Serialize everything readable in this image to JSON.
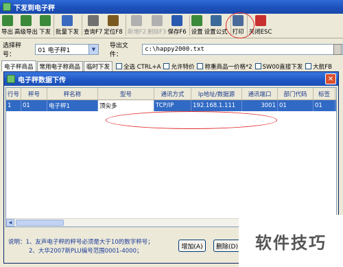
{
  "window": {
    "title": "下发到电子秤"
  },
  "toolbar": {
    "buttons": [
      {
        "label": "导出",
        "icon": "export-icon",
        "color": "#3a8a3a"
      },
      {
        "label": "高级导出",
        "icon": "advanced-export-icon",
        "color": "#3a8a3a"
      },
      {
        "label": "下发",
        "icon": "send-icon",
        "color": "#3a8a3a"
      },
      {
        "label": "批量下发",
        "icon": "batch-send-icon",
        "color": "#3a6ac0"
      },
      {
        "label": "查询F7",
        "icon": "query-icon",
        "color": "#707070"
      },
      {
        "label": "定位F8",
        "icon": "locate-icon",
        "color": "#7a5a20"
      },
      {
        "label": "新增F2",
        "icon": "add-icon",
        "color": "#b0b0b0"
      },
      {
        "label": "删除F3",
        "icon": "delete-icon",
        "color": "#b0b0b0"
      },
      {
        "label": "保存F6",
        "icon": "save-icon",
        "color": "#2a5ab0"
      },
      {
        "label": "设置",
        "icon": "settings-icon",
        "color": "#3a8a3a"
      },
      {
        "label": "设置公式",
        "icon": "formula-settings-icon",
        "color": "#3a6a9a"
      },
      {
        "label": "打印",
        "icon": "print-icon",
        "color": "#4a6a9a"
      },
      {
        "label": "关闭ESC",
        "icon": "close-window-icon",
        "color": "#c83030"
      }
    ]
  },
  "filter": {
    "scale_label": "选择秤号：",
    "scale_value": "01 电子秤1",
    "file_label": "导出文件：",
    "file_value": "c:\\happy2000.txt"
  },
  "tabs": [
    "电子秤商品",
    "常用电子称商品",
    "临时下发"
  ],
  "checkboxes": [
    "全选 CTRL+A",
    "允许特价",
    "称重商品一价格*2",
    "SW00直接下发",
    "大航FB"
  ],
  "dialog": {
    "title": "电子秤数据下传",
    "columns": [
      "行号",
      "秤号",
      "秤名称",
      "型号",
      "通讯方式",
      "Ip地址/数据源",
      "通讯端口",
      "部门代码",
      "标签"
    ],
    "rows": [
      [
        "1",
        "01",
        "电子秤1",
        "顶尖多",
        "TCP/IP",
        "192.168.1.111",
        "3001",
        "01",
        "01"
      ]
    ],
    "note_line1": "说明：1、友声电子秤的秤号必须是大于10的数字秤号；",
    "note_line2": "2、大华2007新PLU编号范围0001-4000；",
    "add_label": "增加(A)",
    "delete_label": "删除(D)"
  },
  "watermark": "软件技巧"
}
